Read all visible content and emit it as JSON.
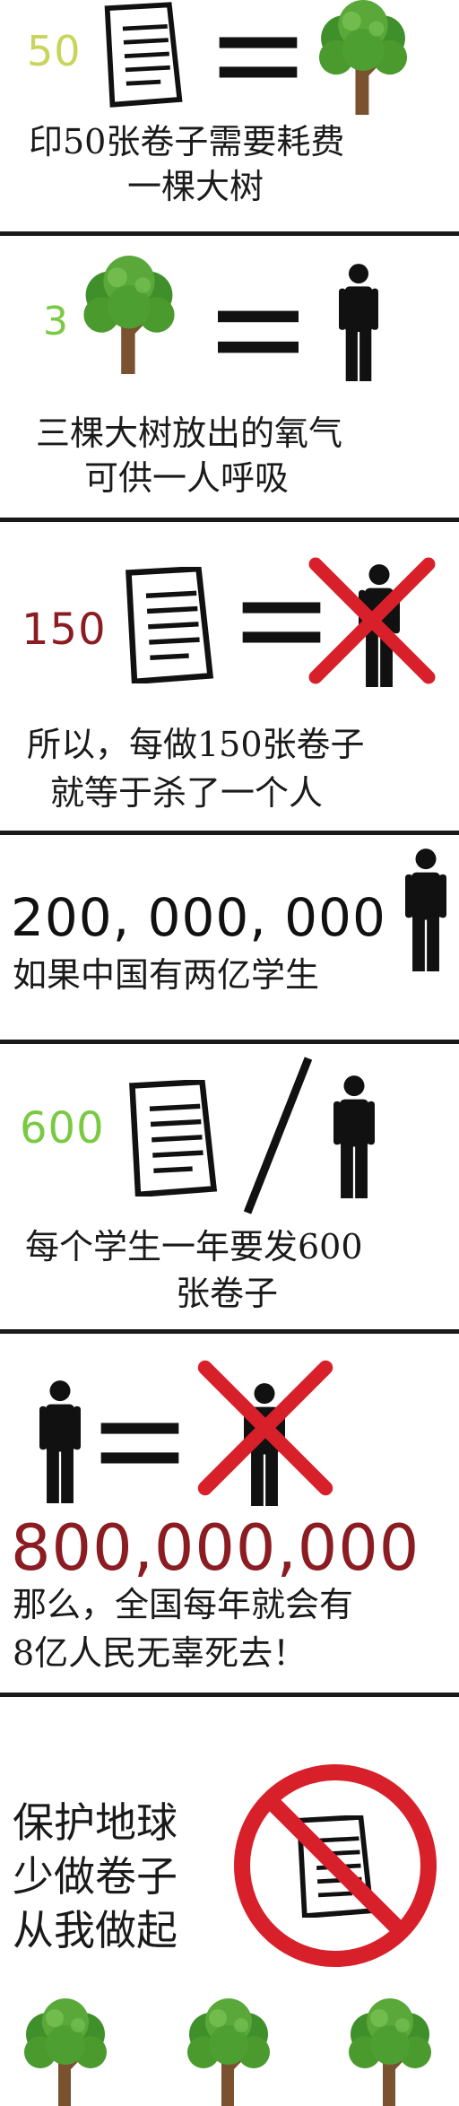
{
  "colors": {
    "green_number": "#7ac943",
    "dark_red_number": "#8b1c22",
    "red_mark": "#d8202b",
    "text": "#1a1a1a",
    "tree_leaf": "#4a9a2e",
    "tree_trunk": "#7a5230"
  },
  "panel1": {
    "number": "50",
    "caption_line1": "印50张卷子需要耗费",
    "caption_line2": "一棵大树"
  },
  "panel2": {
    "number": "3",
    "caption_line1": "三棵大树放出的氧气",
    "caption_line2": "可供一人呼吸"
  },
  "panel3": {
    "number": "150",
    "caption_line1": "所以，每做150张卷子",
    "caption_line2": "就等于杀了一个人"
  },
  "panel4": {
    "number": "200, 000, 000",
    "caption_line1": "如果中国有两亿学生"
  },
  "panel5": {
    "number": "600",
    "caption_line1": "每个学生一年要发600",
    "caption_line2": "张卷子"
  },
  "panel6": {
    "number": "800,000,000",
    "caption_line1": "那么，全国每年就会有",
    "caption_line2": "8亿人民无辜死去！"
  },
  "panel7": {
    "caption_line1": "保护地球",
    "caption_line2": "少做卷子",
    "caption_line3": "从我做起"
  },
  "icons": {
    "paper": "paper-document-icon",
    "tree": "tree-icon",
    "person": "person-icon",
    "equals": "equals-sign",
    "cross": "red-cross-icon",
    "prohibited": "prohibition-sign-icon"
  }
}
